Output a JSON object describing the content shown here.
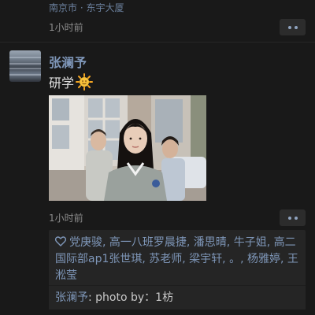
{
  "previous_post": {
    "location": "南京市 · 东宇大厦",
    "time": "1小时前"
  },
  "post": {
    "author": "张澜予",
    "caption_text": "研学",
    "caption_emoji": "sun-with-face-icon",
    "photo_alt": "photo",
    "time": "1小时前"
  },
  "likes": {
    "icon": "heart-outline-icon",
    "names": "党庚骏, 高一八班罗晨捷, 潘思晴, 牛子姐, 高二国际部ap1张世琪, 苏老师, 梁宇轩, 。, 杨雅婷, 王淞莹"
  },
  "comment": {
    "author": "张澜予",
    "separator": ": ",
    "text": "photo by：1枋"
  },
  "colors": {
    "background": "#191919",
    "link_blue": "#7e96b8",
    "panel": "#252525"
  }
}
